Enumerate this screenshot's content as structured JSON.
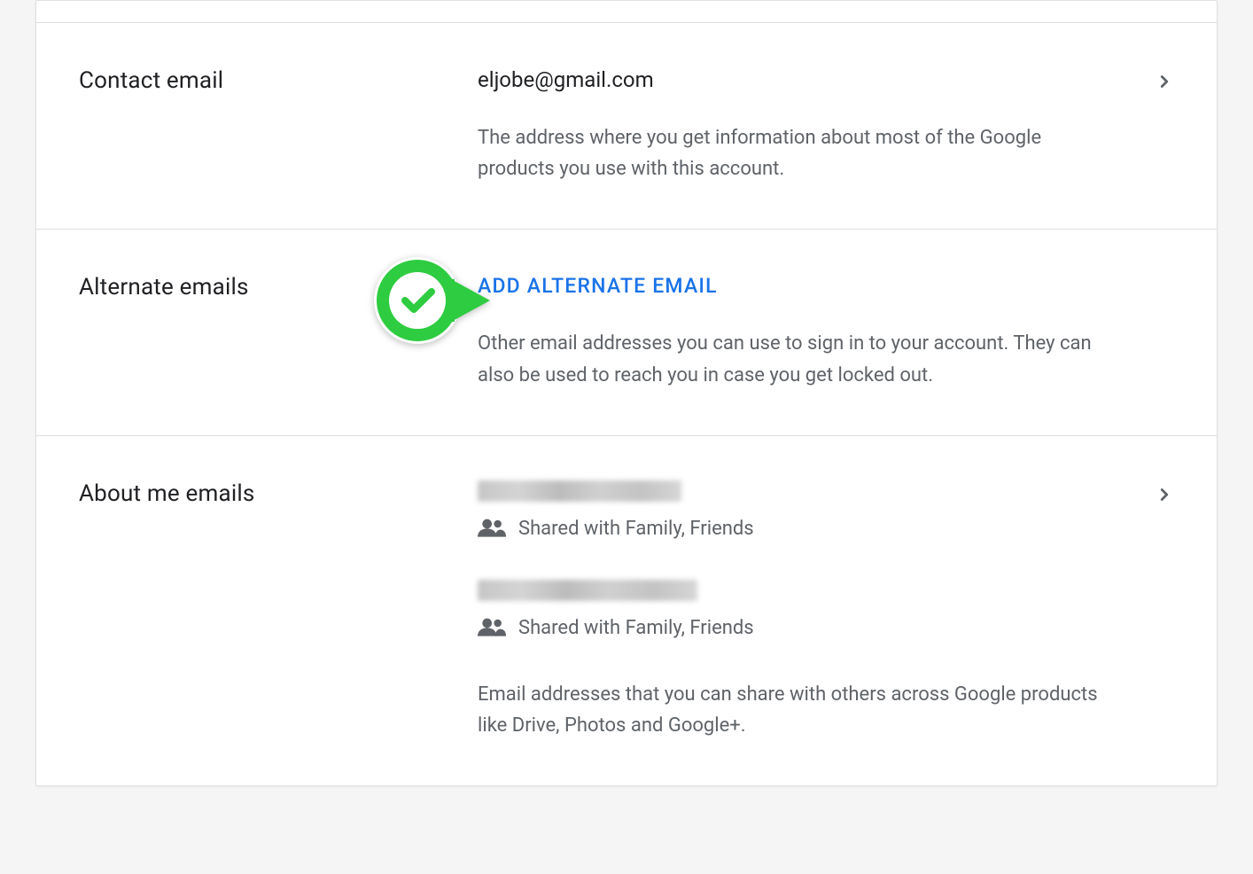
{
  "contact_email": {
    "label": "Contact email",
    "value": "eljobe@gmail.com",
    "description": "The address where you get information about most of the Google products you use with this account."
  },
  "alternate_emails": {
    "label": "Alternate emails",
    "action": "ADD ALTERNATE EMAIL",
    "description": "Other email addresses you can use to sign in to your account. They can also be used to reach you in case you get locked out."
  },
  "about_me_emails": {
    "label": "About me emails",
    "shared1": "Shared with Family, Friends",
    "shared2": "Shared with Family, Friends",
    "description": "Email addresses that you can share with others across Google products like Drive, Photos and Google+."
  }
}
